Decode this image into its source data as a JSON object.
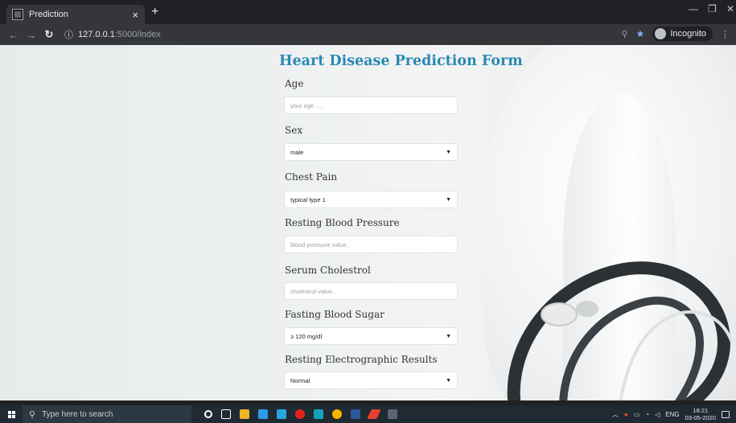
{
  "browser": {
    "tab_title": "Prediction",
    "close_glyph": "×",
    "new_tab_glyph": "+",
    "url_host": "127.0.0.1",
    "url_path": ":5000/index",
    "profile_label": "Incognito",
    "icons": [
      "back-arrow-icon",
      "forward-arrow-icon",
      "reload-icon",
      "info-icon",
      "zoom-icon",
      "star-icon",
      "incognito-icon"
    ]
  },
  "form": {
    "title": "Heart Disease Prediction Form",
    "fields": [
      {
        "label": "Age",
        "type": "input",
        "placeholder": "your age......"
      },
      {
        "label": "Sex",
        "type": "select",
        "value": "male"
      },
      {
        "label": "Chest Pain",
        "type": "select",
        "value": "typical type 1"
      },
      {
        "label": "Resting Blood Pressure",
        "type": "input",
        "placeholder": "blood pressure value.."
      },
      {
        "label": "Serum Cholestrol",
        "type": "input",
        "placeholder": "cholestrol value.."
      },
      {
        "label": "Fasting Blood Sugar",
        "type": "select",
        "value": "≥ 120 mg/dl"
      },
      {
        "label": "Resting Electrographic Results",
        "type": "select",
        "value": "Normal"
      }
    ]
  },
  "taskbar": {
    "search_placeholder": "Type here to search",
    "language": "ENG",
    "time": "18:21",
    "date": "03-05-2020",
    "colors": {
      "files": "#f0b429",
      "store": "#2e9be8",
      "mail": "#2aa5e0",
      "opera": "#e0231f",
      "chrome": "#f4b400",
      "word": "#2b579a"
    }
  }
}
